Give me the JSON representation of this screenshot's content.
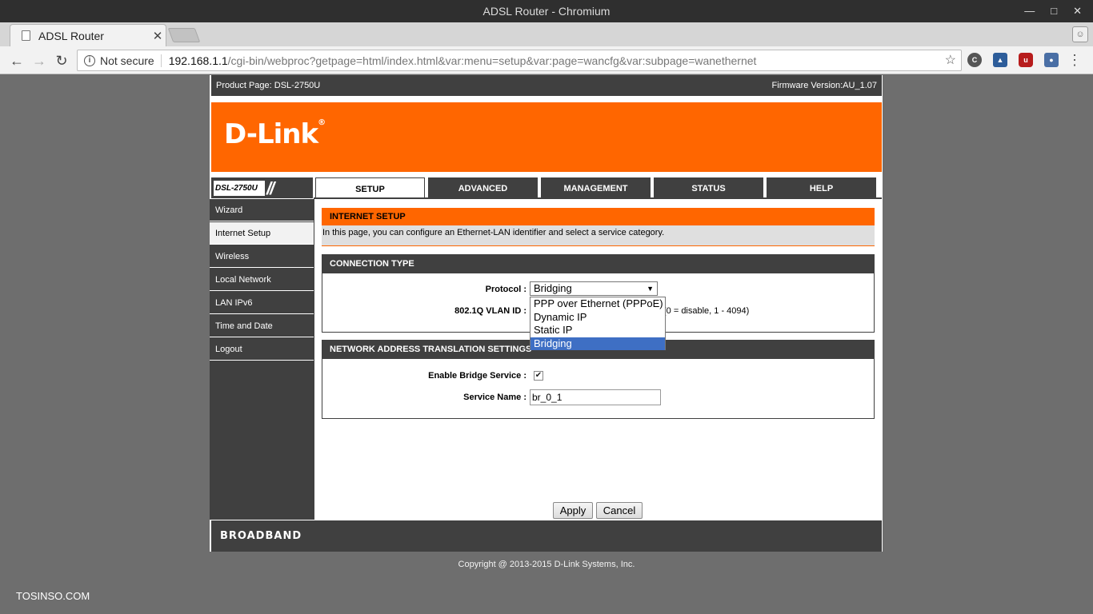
{
  "browser": {
    "window_title": "ADSL Router - Chromium",
    "tab_title": "ADSL Router",
    "security_label": "Not secure",
    "url_host": "192.168.1.1",
    "url_path": "/cgi-bin/webproc?getpage=html/index.html&var:menu=setup&var:page=wancfg&var:subpage=wanethernet"
  },
  "router": {
    "product_page": "Product Page: DSL-2750U",
    "firmware": "Firmware Version:AU_1.07",
    "logo_text": "D-Link",
    "model_tag": "DSL-2750U",
    "brand_color": "#ff6600",
    "dark_color": "#404040",
    "tabs": [
      {
        "label": "SETUP",
        "active": true
      },
      {
        "label": "ADVANCED"
      },
      {
        "label": "MANAGEMENT"
      },
      {
        "label": "STATUS"
      },
      {
        "label": "HELP"
      }
    ],
    "sidebar": [
      {
        "label": "Wizard"
      },
      {
        "label": "Internet Setup",
        "active": true
      },
      {
        "label": "Wireless"
      },
      {
        "label": "Local Network"
      },
      {
        "label": "LAN IPv6"
      },
      {
        "label": "Time and Date"
      },
      {
        "label": "Logout"
      }
    ],
    "internet_setup": {
      "title": "INTERNET SETUP",
      "description": "In this page, you can configure an Ethernet-LAN identifier and select a service category."
    },
    "connection_type": {
      "title": "CONNECTION TYPE",
      "protocol_label": "Protocol :",
      "protocol_value": "Bridging",
      "protocol_options": [
        "PPP over Ethernet (PPPoE)",
        "Dynamic IP",
        "Static IP",
        "Bridging"
      ],
      "vlan_label": "802.1Q VLAN ID :",
      "vlan_hint": "(0 = disable, 1 - 4094)"
    },
    "nat_settings": {
      "title": "NETWORK ADDRESS TRANSLATION SETTINGS",
      "bridge_label": "Enable Bridge Service :",
      "bridge_checked": true,
      "service_name_label": "Service Name :",
      "service_name_value": "br_0_1"
    },
    "buttons": {
      "apply": "Apply",
      "cancel": "Cancel"
    },
    "footer": "BROADBAND",
    "copyright": "Copyright @ 2013-2015 D-Link Systems, Inc."
  },
  "watermark": "TOSINSO.COM"
}
